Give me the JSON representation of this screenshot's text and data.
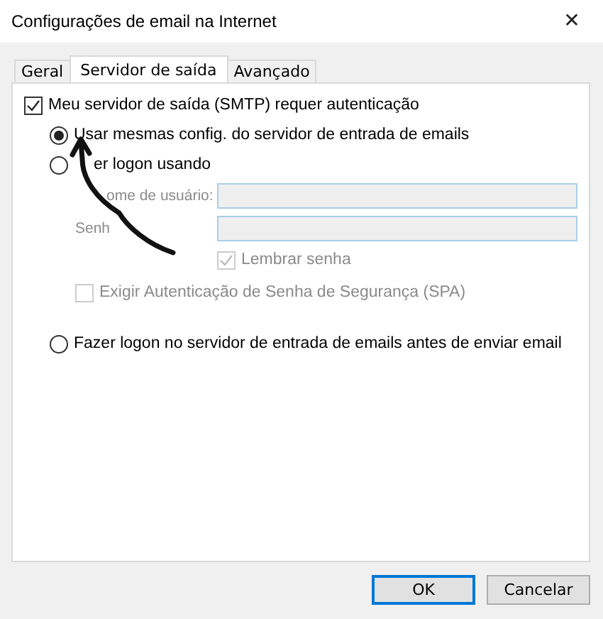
{
  "window": {
    "title": "Configurações de email na Internet",
    "close": "✕"
  },
  "tabs": [
    {
      "label": "Geral",
      "selected": false
    },
    {
      "label": "Servidor de saída",
      "selected": true
    },
    {
      "label": "Avançado",
      "selected": false
    }
  ],
  "auth": {
    "label": "Meu servidor de saída (SMTP) requer autenticação",
    "checked": true
  },
  "options": [
    {
      "kind": "radio",
      "label": "Usar mesmas config. do servidor de entrada de emails",
      "selected": true
    },
    {
      "kind": "radio",
      "label": "er logon usando",
      "selected": false
    },
    {
      "kind": "field",
      "label": "ome de usuário:",
      "disabled": true
    },
    {
      "kind": "field",
      "label": "Senh",
      "disabled": true
    },
    {
      "kind": "fieldcheck",
      "label": "Lembrar senha",
      "checked": true,
      "disabled": true
    },
    {
      "kind": "check",
      "label": "Exigir Autenticação de Senha de Segurança (SPA)",
      "checked": false,
      "disabled": true
    },
    {
      "kind": "radio",
      "label": "Fazer logon no servidor de entrada de emails antes de enviar email",
      "selected": false
    }
  ],
  "buttons": [
    {
      "label": "OK",
      "default": true
    },
    {
      "label": "Cancelar",
      "default": false
    }
  ]
}
